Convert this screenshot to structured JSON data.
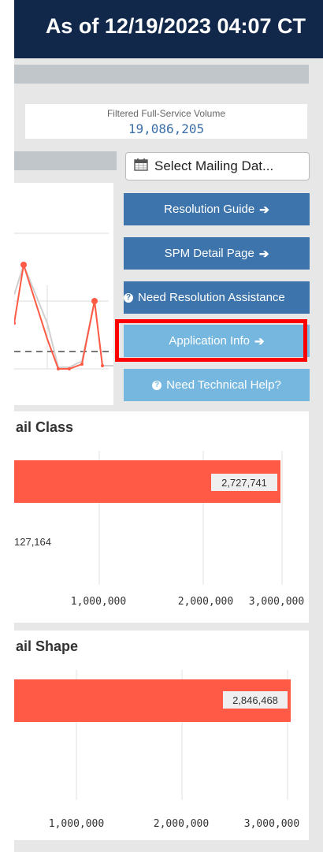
{
  "header": {
    "title": "As of 12/19/2023 04:07 CT"
  },
  "metric": {
    "label": "Filtered Full-Service Volume",
    "value": "19,086,205"
  },
  "date_picker": {
    "label": "Select Mailing Dat..."
  },
  "buttons": {
    "resolution_guide": "Resolution Guide",
    "spm_detail": "SPM Detail Page",
    "need_resolution": "Need Resolution Assistance",
    "application_info": "Application Info",
    "technical_help": "Need Technical Help?"
  },
  "mail_class": {
    "title": "ail Class",
    "bar_label": "2,727,741",
    "second_label": "127,164",
    "ticks": [
      "1,000,000",
      "2,000,000",
      "3,000,000"
    ]
  },
  "mail_shape": {
    "title": "ail Shape",
    "bar_label": "2,846,468",
    "ticks": [
      "1,000,000",
      "2,000,000",
      "3,000,000"
    ]
  },
  "colors": {
    "navy": "#12284b",
    "button_dark": "#3d74ac",
    "button_light": "#76b7df",
    "bar": "#ff5a45",
    "highlight": "#ff0000"
  }
}
